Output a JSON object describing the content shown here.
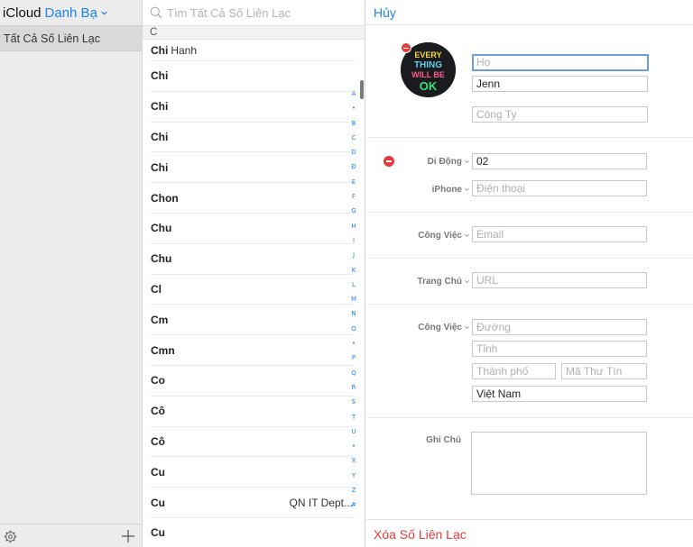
{
  "sidebar": {
    "brand": "iCloud",
    "app_name": "Danh Bạ",
    "items": [
      {
        "label": "Tất Cả Số Liên Lạc"
      }
    ]
  },
  "list": {
    "search_placeholder": "Tìm Tất Cả Số Liên Lạc",
    "section_header": "C",
    "rows": [
      {
        "first": "Chi",
        "last": "Hanh",
        "dept": ""
      },
      {
        "first": "Chi",
        "last": "",
        "dept": ""
      },
      {
        "first": "Chi",
        "last": "",
        "dept": ""
      },
      {
        "first": "Chi",
        "last": "",
        "dept": ""
      },
      {
        "first": "Chi",
        "last": "",
        "dept": ""
      },
      {
        "first": "Chon",
        "last": "",
        "dept": ""
      },
      {
        "first": "Chu",
        "last": "",
        "dept": ""
      },
      {
        "first": "Chu",
        "last": "",
        "dept": ""
      },
      {
        "first": "Cl",
        "last": "",
        "dept": ""
      },
      {
        "first": "Cm",
        "last": "",
        "dept": ""
      },
      {
        "first": "Cmn",
        "last": "",
        "dept": ""
      },
      {
        "first": "Co",
        "last": "",
        "dept": ""
      },
      {
        "first": "Cô",
        "last": "",
        "dept": ""
      },
      {
        "first": "Cô",
        "last": "",
        "dept": ""
      },
      {
        "first": "Cu",
        "last": "",
        "dept": ""
      },
      {
        "first": "Cu",
        "last": "",
        "dept": "QN IT Dept..."
      },
      {
        "first": "Cu",
        "last": "",
        "dept": ""
      }
    ],
    "index": [
      "A",
      "•",
      "B",
      "C",
      "D",
      "Đ",
      "E",
      "F",
      "G",
      "H",
      "I",
      "J",
      "K",
      "L",
      "M",
      "N",
      "O",
      "•",
      "P",
      "Q",
      "R",
      "S",
      "T",
      "U",
      "•",
      "X",
      "Y",
      "Z",
      "#"
    ]
  },
  "detail": {
    "cancel_label": "Hủy",
    "avatar_text": [
      "EVERY",
      "THING",
      "WILL BE",
      "OK"
    ],
    "last_name_placeholder": "Họ",
    "first_name_value": "Jenn",
    "company_placeholder": "Công Ty",
    "phone_label_1": "Di Động",
    "phone_value_1": "02",
    "phone_label_2": "iPhone",
    "phone_placeholder_2": "Điện thoại",
    "email_label": "Công Việc",
    "email_placeholder": "Email",
    "url_label": "Trang Chủ",
    "url_placeholder": "URL",
    "address_label": "Công Việc",
    "street_placeholder": "Đường",
    "province_placeholder": "Tỉnh",
    "city_placeholder": "Thành phố",
    "zip_placeholder": "Mã Thư Tín",
    "country_value": "Việt Nam",
    "notes_label": "Ghi Chú",
    "delete_label": "Xóa Số Liên Lạc"
  },
  "colors": {
    "accent": "#1a82f1",
    "destructive": "#e23b3b",
    "sidebar_bg": "#ececec"
  }
}
